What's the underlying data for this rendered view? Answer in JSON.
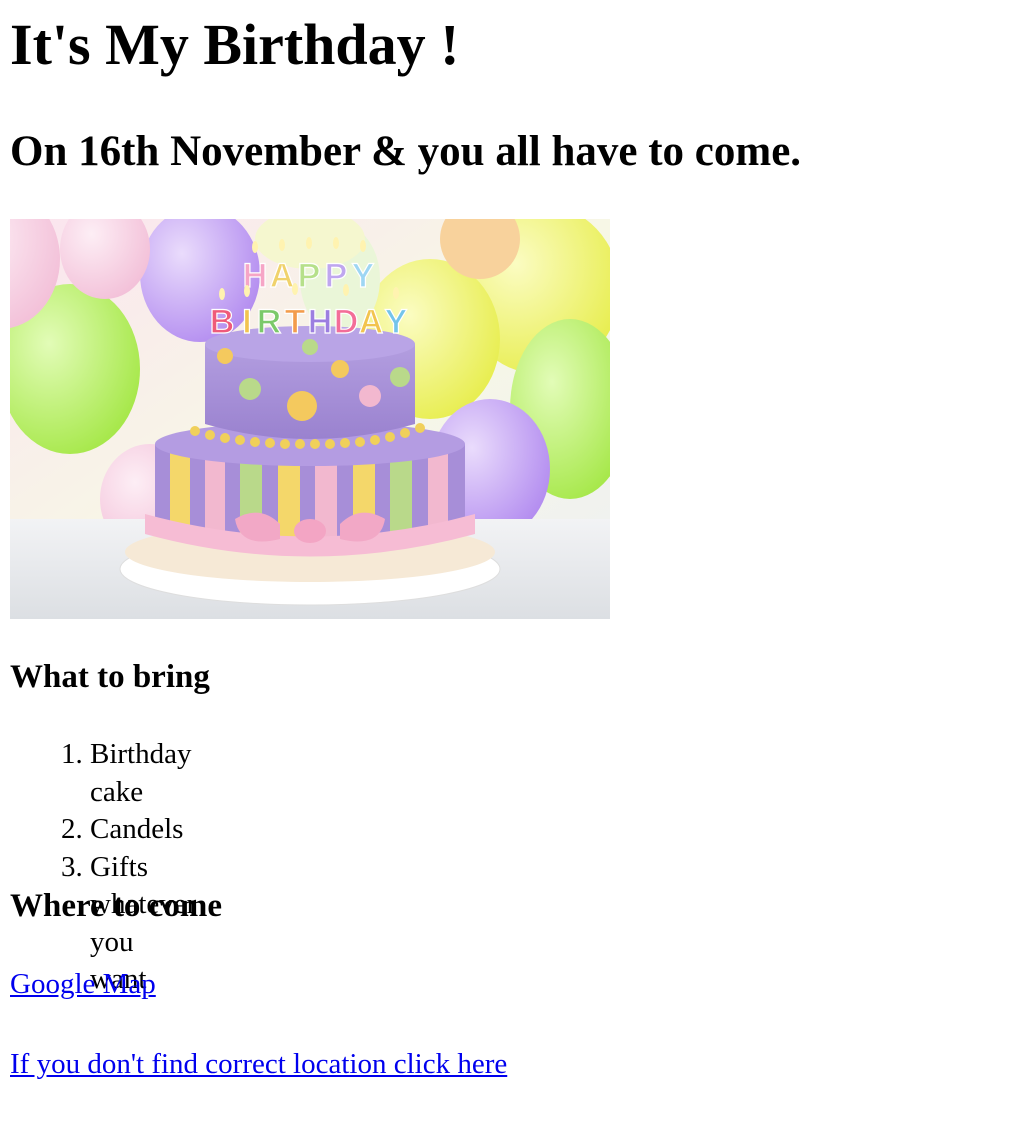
{
  "page": {
    "title": "It's My Birthday !",
    "subtitle": "On 16th November & you all have to come."
  },
  "hero_image": {
    "candle_letters_top": "HAPPY",
    "candle_letters_bottom": "BIRTHDAY",
    "colors": {
      "cake_purple": "#a68fd3",
      "stripe_yellow": "#f4d76a",
      "stripe_green": "#b9d98a",
      "stripe_pink": "#f2b8cf",
      "dot_orange": "#f6c35a",
      "balloon_yellow": "#eef26a",
      "balloon_green": "#b8f06a",
      "balloon_purple": "#c9a8f0"
    }
  },
  "bring": {
    "heading": "What to bring",
    "items": [
      "Birthday cake",
      "Candels",
      "Gifts whatever you want"
    ]
  },
  "where": {
    "heading": "Where to come",
    "map_link": "Google Map",
    "fallback_link": "If you don't find correct location click here"
  }
}
